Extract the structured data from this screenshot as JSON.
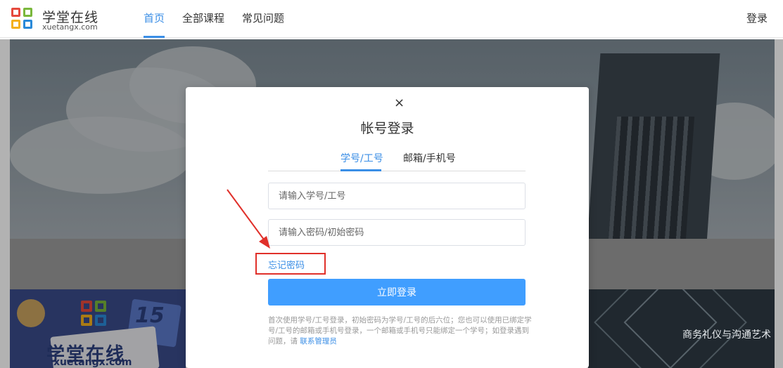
{
  "header": {
    "brand_cn": "学堂在线",
    "brand_en": "xuetangx.com",
    "nav": [
      {
        "label": "首页",
        "active": true
      },
      {
        "label": "全部课程",
        "active": false
      },
      {
        "label": "常见问题",
        "active": false
      }
    ],
    "login": "登录"
  },
  "background": {
    "banner_left_number": "15",
    "banner_left_cn": "学堂在线",
    "banner_left_en": "xuetangx.com",
    "banner_right_text": "商务礼仪与沟通艺术"
  },
  "modal": {
    "close_symbol": "×",
    "title": "帐号登录",
    "tabs": [
      {
        "label": "学号/工号",
        "active": true
      },
      {
        "label": "邮箱/手机号",
        "active": false
      }
    ],
    "username_placeholder": "请输入学号/工号",
    "password_placeholder": "请输入密码/初始密码",
    "forgot_password": "忘记密码",
    "submit": "立即登录",
    "hint_text": "首次使用学号/工号登录，初始密码为学号/工号的后六位；您也可以使用已绑定学号/工号的邮箱或手机号登录，一个邮箱或手机号只能绑定一个学号；如登录遇到问题，请 ",
    "contact_admin": "联系管理员"
  },
  "colors": {
    "accent": "#3a8ee6",
    "button": "#409eff",
    "annotation": "#e0302a"
  }
}
